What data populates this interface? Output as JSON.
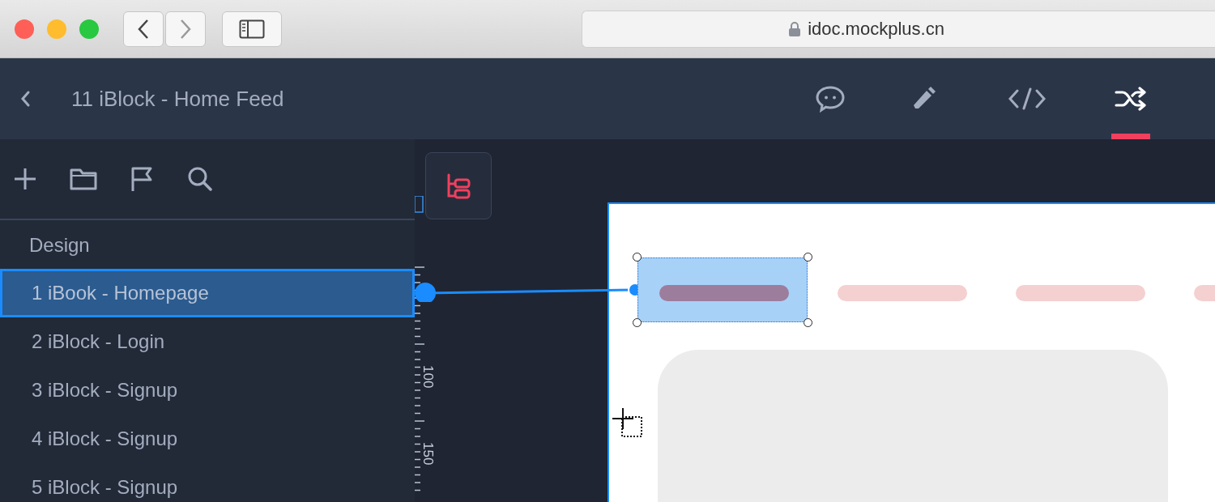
{
  "browser": {
    "url": "idoc.mockplus.cn"
  },
  "header": {
    "title": "11 iBlock - Home Feed",
    "tabs": [
      {
        "kind": "comment",
        "selected": false
      },
      {
        "kind": "edit",
        "selected": false
      },
      {
        "kind": "code",
        "selected": false
      },
      {
        "kind": "interaction",
        "selected": true
      }
    ]
  },
  "sidebar": {
    "section": "Design",
    "pages": [
      {
        "label": "1 iBook - Homepage",
        "selected": true
      },
      {
        "label": "2 iBlock - Login",
        "selected": false
      },
      {
        "label": "3 iBlock - Signup",
        "selected": false
      },
      {
        "label": "4 iBlock - Signup",
        "selected": false
      },
      {
        "label": "5 iBlock - Signup",
        "selected": false
      }
    ]
  },
  "ruler": {
    "labels": [
      "100",
      "150"
    ]
  },
  "artboard": {
    "pills": [
      {
        "selected": true
      },
      {
        "selected": false
      },
      {
        "selected": false
      },
      {
        "selected": false
      }
    ]
  }
}
